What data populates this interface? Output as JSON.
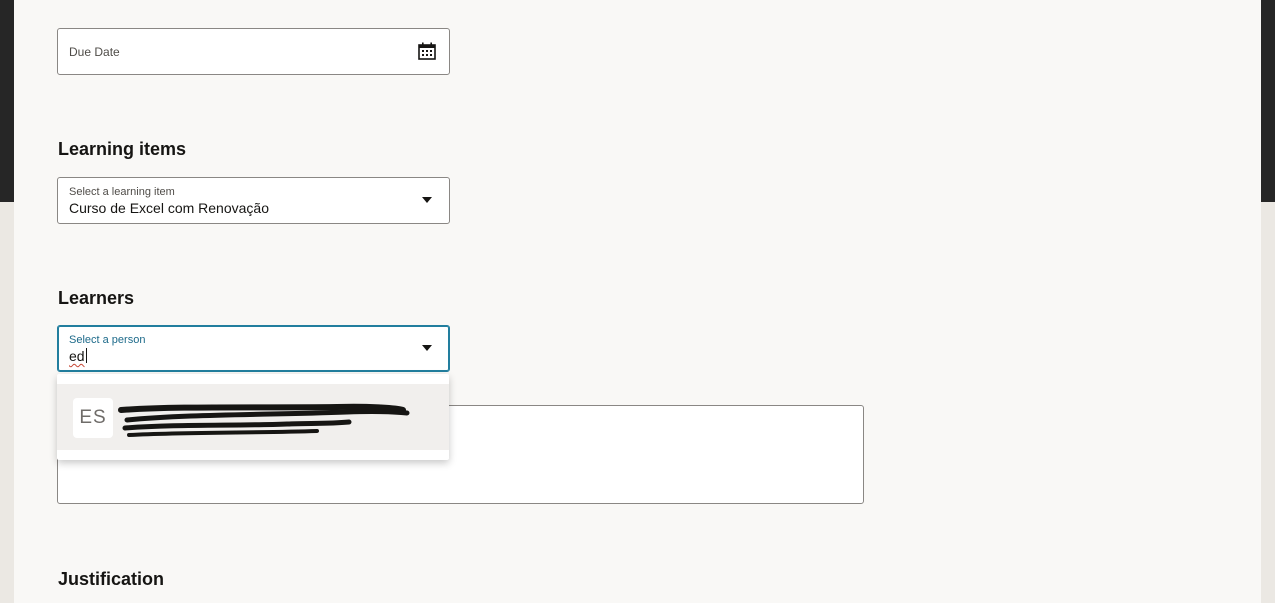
{
  "due_date": {
    "label": "Due Date",
    "icon": "calendar-icon"
  },
  "learning_items": {
    "title": "Learning items",
    "select_label": "Select a learning item",
    "value": "Curso de Excel com Renovação",
    "icon": "chevron-down-icon"
  },
  "learners": {
    "title": "Learners",
    "select_label": "Select a person",
    "typed_value": "ed",
    "icon": "chevron-down-icon",
    "results": [
      {
        "initials": "ES",
        "name_redacted": true
      }
    ]
  },
  "justification": {
    "title": "Justification"
  },
  "colors": {
    "focus_border": "#227e9e",
    "background": "#f9f8f6",
    "header_dark": "#262626"
  }
}
